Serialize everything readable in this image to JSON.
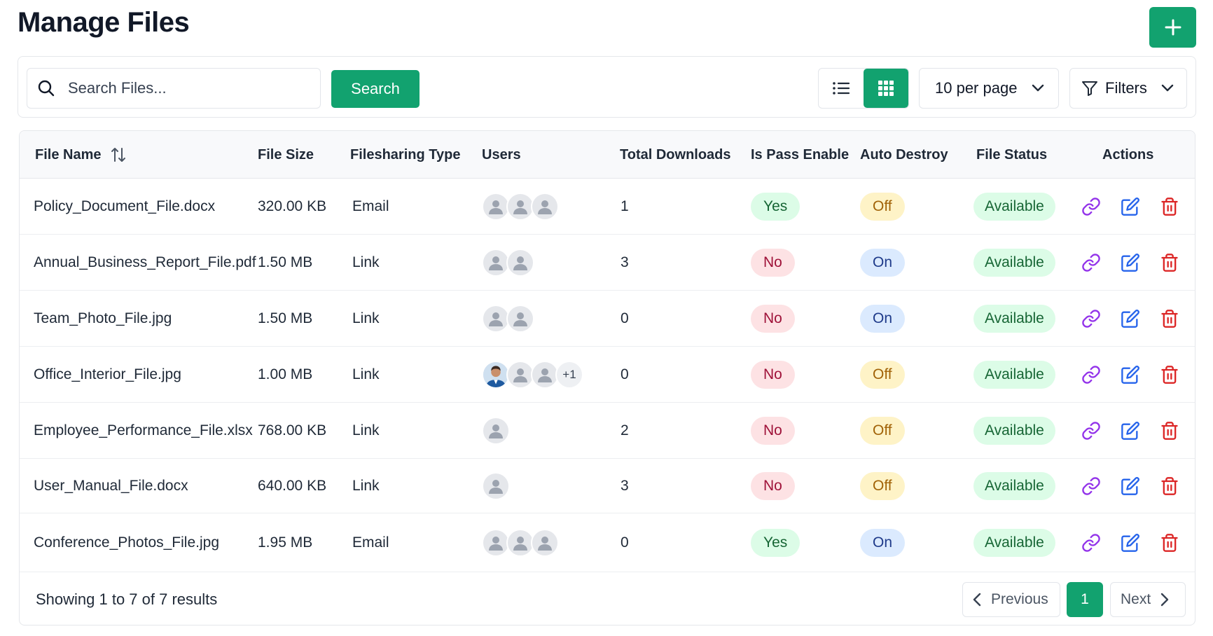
{
  "page": {
    "title": "Manage Files"
  },
  "toolbar": {
    "add_button": "add-file",
    "search_placeholder": "Search Files...",
    "search_button": "Search",
    "per_page": "10 per page",
    "filters": "Filters",
    "view_mode": "grid"
  },
  "colors": {
    "accent": "#12a26f",
    "link_icon": "#9333ea",
    "edit_icon": "#2563eb",
    "delete_icon": "#dc2626"
  },
  "table": {
    "headers": {
      "file_name": "File Name",
      "file_size": "File Size",
      "sharing_type": "Filesharing Type",
      "users": "Users",
      "downloads": "Total Downloads",
      "pass": "Is Pass Enable",
      "auto_destroy": "Auto Destroy",
      "status": "File Status",
      "actions": "Actions"
    },
    "rows": [
      {
        "name": "Policy_Document_File.docx",
        "size": "320.00 KB",
        "type": "Email",
        "users": [
          "user",
          "user",
          "user"
        ],
        "extra": "",
        "downloads": "1",
        "pass": "Yes",
        "auto_destroy": "Off",
        "status": "Available"
      },
      {
        "name": "Annual_Business_Report_File.pdf",
        "size": "1.50 MB",
        "type": "Link",
        "users": [
          "user",
          "user"
        ],
        "extra": "",
        "downloads": "3",
        "pass": "No",
        "auto_destroy": "On",
        "status": "Available"
      },
      {
        "name": "Team_Photo_File.jpg",
        "size": "1.50 MB",
        "type": "Link",
        "users": [
          "user",
          "user"
        ],
        "extra": "",
        "downloads": "0",
        "pass": "No",
        "auto_destroy": "On",
        "status": "Available"
      },
      {
        "name": "Office_Interior_File.jpg",
        "size": "1.00 MB",
        "type": "Link",
        "users": [
          "photo",
          "user",
          "user"
        ],
        "extra": "+1",
        "downloads": "0",
        "pass": "No",
        "auto_destroy": "Off",
        "status": "Available"
      },
      {
        "name": "Employee_Performance_File.xlsx",
        "size": "768.00 KB",
        "type": "Link",
        "users": [
          "user"
        ],
        "extra": "",
        "downloads": "2",
        "pass": "No",
        "auto_destroy": "Off",
        "status": "Available"
      },
      {
        "name": "User_Manual_File.docx",
        "size": "640.00 KB",
        "type": "Link",
        "users": [
          "user"
        ],
        "extra": "",
        "downloads": "3",
        "pass": "No",
        "auto_destroy": "Off",
        "status": "Available"
      },
      {
        "name": "Conference_Photos_File.jpg",
        "size": "1.95 MB",
        "type": "Email",
        "users": [
          "user",
          "user",
          "user"
        ],
        "extra": "",
        "downloads": "0",
        "pass": "Yes",
        "auto_destroy": "On",
        "status": "Available"
      }
    ]
  },
  "pagination": {
    "summary": "Showing 1 to 7 of 7 results",
    "previous": "Previous",
    "current": "1",
    "next": "Next"
  }
}
